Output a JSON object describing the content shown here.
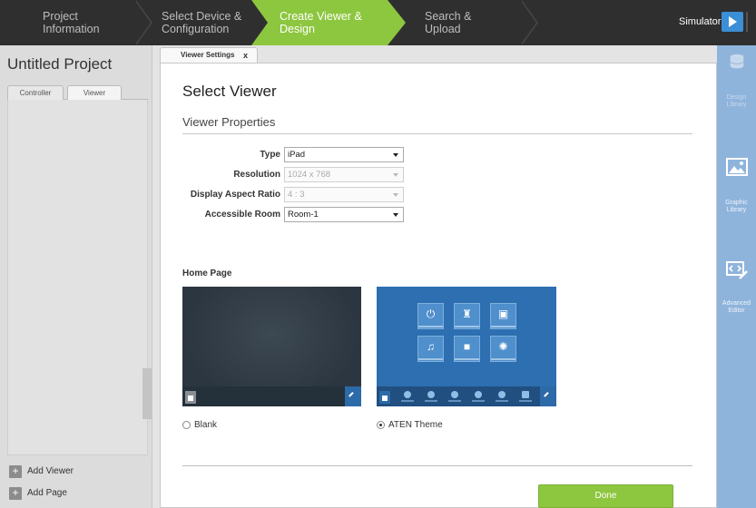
{
  "wizard": {
    "steps": [
      {
        "line1": "Project",
        "line2": "Information"
      },
      {
        "line1": "Select Device &",
        "line2": "Configuration"
      },
      {
        "line1": "Create Viewer &",
        "line2": "Design"
      },
      {
        "line1": "Search &",
        "line2": "Upload"
      }
    ],
    "active_step": "Create Viewer & Design",
    "simulator_label": "Simulator",
    "accent_color": "#8dc63f"
  },
  "sidebar": {
    "project_title": "Untitled Project",
    "tabs": [
      {
        "label": "Controller"
      },
      {
        "label": "Viewer"
      }
    ],
    "actions": [
      {
        "label": "Add Viewer"
      },
      {
        "label": "Add Page"
      }
    ]
  },
  "document": {
    "tab_label": "Viewer Settings",
    "tab_close": "x",
    "title": "Select Viewer",
    "section_title": "Viewer Properties",
    "properties": [
      {
        "label": "Type",
        "value": "iPad",
        "enabled": true
      },
      {
        "label": "Resolution",
        "value": "1024 x 768",
        "enabled": false
      },
      {
        "label": "Display Aspect Ratio",
        "value": "4 : 3",
        "enabled": false
      },
      {
        "label": "Accessible Room",
        "value": "Room-1",
        "enabled": true
      }
    ],
    "home_page_label": "Home Page",
    "home_options": [
      {
        "label": "Blank",
        "selected": false
      },
      {
        "label": "ATEN Theme",
        "selected": true
      }
    ],
    "done_label": "Done"
  },
  "right_rail": {
    "items": [
      {
        "icon": "database-icon",
        "label_line1": "Design",
        "label_line2": "Library"
      },
      {
        "icon": "image-icon",
        "label_line1": "Graphic",
        "label_line2": "Library"
      },
      {
        "icon": "code-editor-icon",
        "label_line1": "Advanced",
        "label_line2": "Editor"
      }
    ]
  }
}
